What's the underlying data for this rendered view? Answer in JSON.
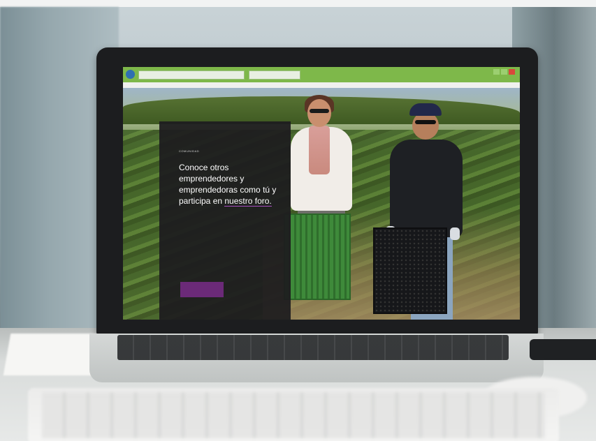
{
  "panel": {
    "eyebrow": "COMUNIDAD",
    "headline_part1": "Conoce otros emprendedores y emprendedoras como tú y participa en ",
    "headline_link": "nuestro foro.",
    "paragraph": "",
    "cta_label": ""
  },
  "colors": {
    "panel_bg": "#1e1d1f",
    "accent_purple": "#6b2a78",
    "browser_bar": "#7eb84a"
  },
  "icons": {
    "browser_back": "back-arrow-icon",
    "window_controls": "window-controls-icon"
  }
}
